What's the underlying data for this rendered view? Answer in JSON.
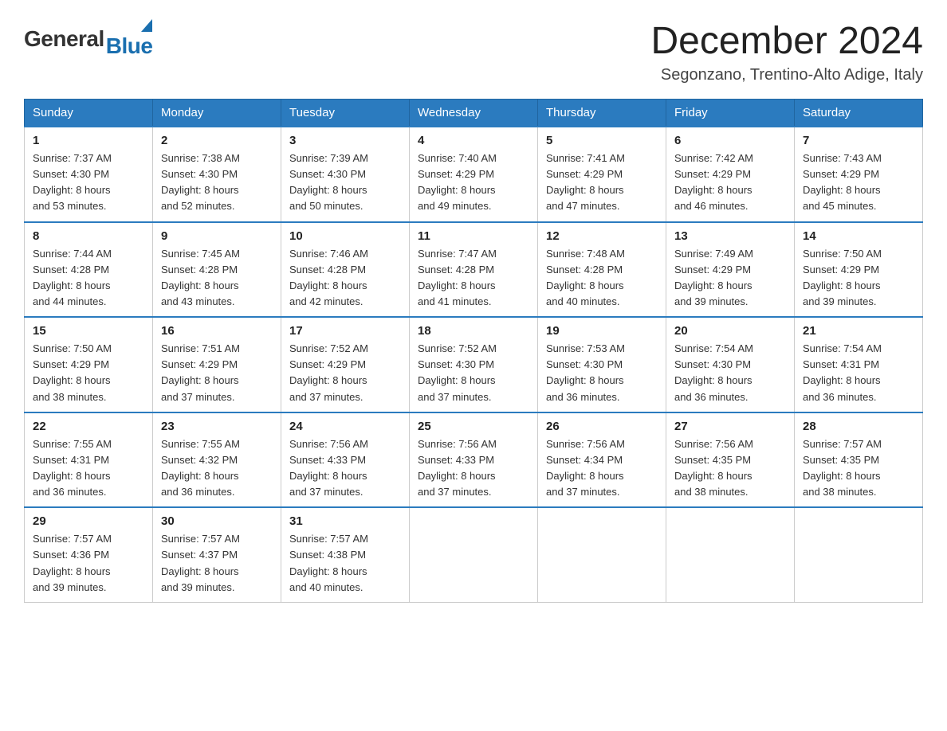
{
  "header": {
    "logo_general": "General",
    "logo_blue": "Blue",
    "month_title": "December 2024",
    "location": "Segonzano, Trentino-Alto Adige, Italy"
  },
  "days_of_week": [
    "Sunday",
    "Monday",
    "Tuesday",
    "Wednesday",
    "Thursday",
    "Friday",
    "Saturday"
  ],
  "weeks": [
    [
      {
        "day": "1",
        "sunrise": "7:37 AM",
        "sunset": "4:30 PM",
        "daylight": "8 hours and 53 minutes."
      },
      {
        "day": "2",
        "sunrise": "7:38 AM",
        "sunset": "4:30 PM",
        "daylight": "8 hours and 52 minutes."
      },
      {
        "day": "3",
        "sunrise": "7:39 AM",
        "sunset": "4:30 PM",
        "daylight": "8 hours and 50 minutes."
      },
      {
        "day": "4",
        "sunrise": "7:40 AM",
        "sunset": "4:29 PM",
        "daylight": "8 hours and 49 minutes."
      },
      {
        "day": "5",
        "sunrise": "7:41 AM",
        "sunset": "4:29 PM",
        "daylight": "8 hours and 47 minutes."
      },
      {
        "day": "6",
        "sunrise": "7:42 AM",
        "sunset": "4:29 PM",
        "daylight": "8 hours and 46 minutes."
      },
      {
        "day": "7",
        "sunrise": "7:43 AM",
        "sunset": "4:29 PM",
        "daylight": "8 hours and 45 minutes."
      }
    ],
    [
      {
        "day": "8",
        "sunrise": "7:44 AM",
        "sunset": "4:28 PM",
        "daylight": "8 hours and 44 minutes."
      },
      {
        "day": "9",
        "sunrise": "7:45 AM",
        "sunset": "4:28 PM",
        "daylight": "8 hours and 43 minutes."
      },
      {
        "day": "10",
        "sunrise": "7:46 AM",
        "sunset": "4:28 PM",
        "daylight": "8 hours and 42 minutes."
      },
      {
        "day": "11",
        "sunrise": "7:47 AM",
        "sunset": "4:28 PM",
        "daylight": "8 hours and 41 minutes."
      },
      {
        "day": "12",
        "sunrise": "7:48 AM",
        "sunset": "4:28 PM",
        "daylight": "8 hours and 40 minutes."
      },
      {
        "day": "13",
        "sunrise": "7:49 AM",
        "sunset": "4:29 PM",
        "daylight": "8 hours and 39 minutes."
      },
      {
        "day": "14",
        "sunrise": "7:50 AM",
        "sunset": "4:29 PM",
        "daylight": "8 hours and 39 minutes."
      }
    ],
    [
      {
        "day": "15",
        "sunrise": "7:50 AM",
        "sunset": "4:29 PM",
        "daylight": "8 hours and 38 minutes."
      },
      {
        "day": "16",
        "sunrise": "7:51 AM",
        "sunset": "4:29 PM",
        "daylight": "8 hours and 37 minutes."
      },
      {
        "day": "17",
        "sunrise": "7:52 AM",
        "sunset": "4:29 PM",
        "daylight": "8 hours and 37 minutes."
      },
      {
        "day": "18",
        "sunrise": "7:52 AM",
        "sunset": "4:30 PM",
        "daylight": "8 hours and 37 minutes."
      },
      {
        "day": "19",
        "sunrise": "7:53 AM",
        "sunset": "4:30 PM",
        "daylight": "8 hours and 36 minutes."
      },
      {
        "day": "20",
        "sunrise": "7:54 AM",
        "sunset": "4:30 PM",
        "daylight": "8 hours and 36 minutes."
      },
      {
        "day": "21",
        "sunrise": "7:54 AM",
        "sunset": "4:31 PM",
        "daylight": "8 hours and 36 minutes."
      }
    ],
    [
      {
        "day": "22",
        "sunrise": "7:55 AM",
        "sunset": "4:31 PM",
        "daylight": "8 hours and 36 minutes."
      },
      {
        "day": "23",
        "sunrise": "7:55 AM",
        "sunset": "4:32 PM",
        "daylight": "8 hours and 36 minutes."
      },
      {
        "day": "24",
        "sunrise": "7:56 AM",
        "sunset": "4:33 PM",
        "daylight": "8 hours and 37 minutes."
      },
      {
        "day": "25",
        "sunrise": "7:56 AM",
        "sunset": "4:33 PM",
        "daylight": "8 hours and 37 minutes."
      },
      {
        "day": "26",
        "sunrise": "7:56 AM",
        "sunset": "4:34 PM",
        "daylight": "8 hours and 37 minutes."
      },
      {
        "day": "27",
        "sunrise": "7:56 AM",
        "sunset": "4:35 PM",
        "daylight": "8 hours and 38 minutes."
      },
      {
        "day": "28",
        "sunrise": "7:57 AM",
        "sunset": "4:35 PM",
        "daylight": "8 hours and 38 minutes."
      }
    ],
    [
      {
        "day": "29",
        "sunrise": "7:57 AM",
        "sunset": "4:36 PM",
        "daylight": "8 hours and 39 minutes."
      },
      {
        "day": "30",
        "sunrise": "7:57 AM",
        "sunset": "4:37 PM",
        "daylight": "8 hours and 39 minutes."
      },
      {
        "day": "31",
        "sunrise": "7:57 AM",
        "sunset": "4:38 PM",
        "daylight": "8 hours and 40 minutes."
      },
      null,
      null,
      null,
      null
    ]
  ],
  "labels": {
    "sunrise": "Sunrise:",
    "sunset": "Sunset:",
    "daylight": "Daylight:"
  }
}
